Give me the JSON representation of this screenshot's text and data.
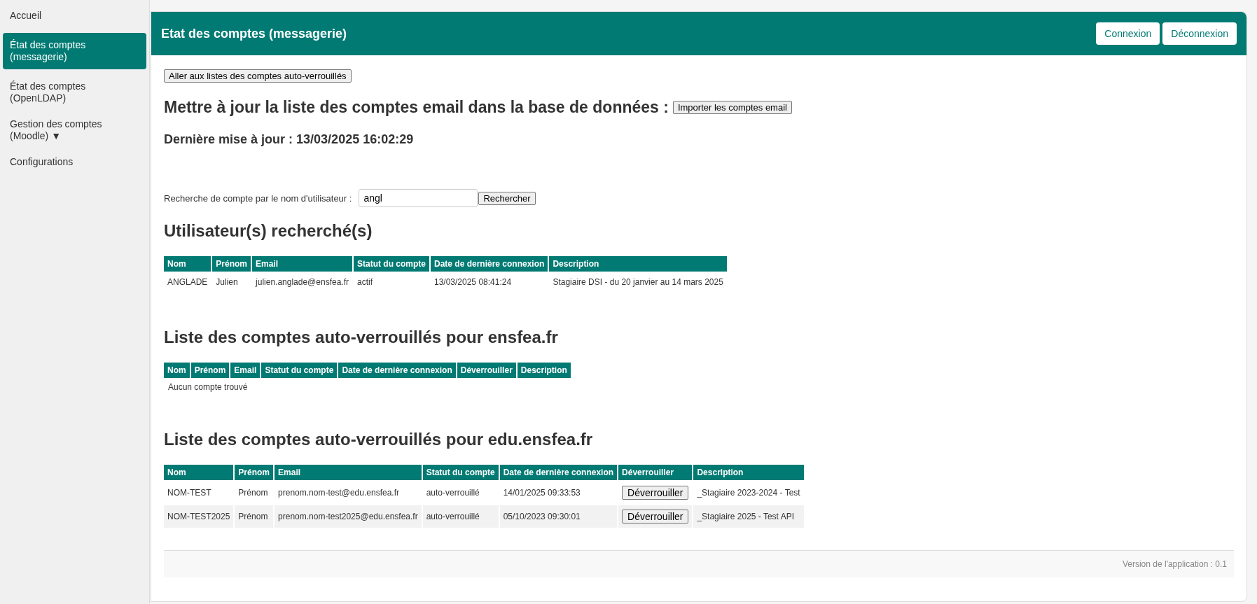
{
  "sidebar": {
    "items": [
      {
        "lines": [
          "Accueil"
        ],
        "selected": false
      },
      {
        "lines": [
          "État des comptes",
          "(messagerie)"
        ],
        "selected": true
      },
      {
        "lines": [
          "État des comptes",
          "(OpenLDAP)"
        ],
        "selected": false
      },
      {
        "lines": [
          "Gestion des comptes",
          "(Moodle) ▼"
        ],
        "selected": false
      },
      {
        "lines": [
          "Configurations"
        ],
        "selected": false
      }
    ]
  },
  "header": {
    "title": "Etat des comptes (messagerie)",
    "buttons": [
      "Connexion",
      "Déconnexion"
    ]
  },
  "goto_button": "Aller aux listes des comptes auto-verrouillés",
  "update": {
    "heading": "Mettre à jour la liste des comptes email dans la base de données :",
    "button": "Importer les comptes email",
    "last_update": "Dernière mise à jour : 13/03/2025 16:02:29"
  },
  "search": {
    "label": "Recherche de compte par le nom d'utilisateur :",
    "value": "angl",
    "button": "Rechercher"
  },
  "sections": [
    {
      "heading": "Utilisateur(s) recherché(s)",
      "columns": [
        "Nom",
        "Prénom",
        "Email",
        "Statut du compte",
        "Date de dernière connexion",
        "Description"
      ],
      "rows": [
        [
          {
            "kind": "text",
            "text": "ANGLADE"
          },
          {
            "kind": "text",
            "text": "Julien"
          },
          {
            "kind": "text",
            "text": "julien.anglade@ensfea.fr"
          },
          {
            "kind": "text",
            "text": "actif"
          },
          {
            "kind": "text",
            "text": "13/03/2025 08:41:24"
          },
          {
            "kind": "text",
            "text": "Stagiaire DSI - du 20 janvier au 14 mars 2025"
          }
        ]
      ]
    },
    {
      "heading": "Liste des comptes auto-verrouillés pour ensfea.fr",
      "columns": [
        "Nom",
        "Prénom",
        "Email",
        "Statut du compte",
        "Date de dernière connexion",
        "Déverrouiller",
        "Description"
      ],
      "empty": "Aucun compte trouvé"
    },
    {
      "heading": "Liste des comptes auto-verrouillés pour edu.ensfea.fr",
      "columns": [
        "Nom",
        "Prénom",
        "Email",
        "Statut du compte",
        "Date de dernière connexion",
        "Déverrouiller",
        "Description"
      ],
      "rows": [
        [
          {
            "kind": "text",
            "text": "NOM-TEST"
          },
          {
            "kind": "text",
            "text": "Prénom"
          },
          {
            "kind": "text",
            "text": "prenom.nom-test@edu.ensfea.fr"
          },
          {
            "kind": "text",
            "text": "auto-verrouillé"
          },
          {
            "kind": "text",
            "text": "14/01/2025 09:33:53"
          },
          {
            "kind": "button",
            "text": "Déverrouiller"
          },
          {
            "kind": "text",
            "text": "_Stagiaire 2023-2024 - Test"
          }
        ],
        [
          {
            "kind": "text",
            "text": "NOM-TEST2025"
          },
          {
            "kind": "text",
            "text": "Prénom"
          },
          {
            "kind": "text",
            "text": "prenom.nom-test2025@edu.ensfea.fr"
          },
          {
            "kind": "text",
            "text": "auto-verrouillé"
          },
          {
            "kind": "text",
            "text": "05/10/2023 09:30:01"
          },
          {
            "kind": "button",
            "text": "Déverrouiller"
          },
          {
            "kind": "text",
            "text": "_Stagiaire 2025 - Test API"
          }
        ]
      ]
    }
  ],
  "footer": {
    "version": "Version de l'application : 0.1"
  }
}
